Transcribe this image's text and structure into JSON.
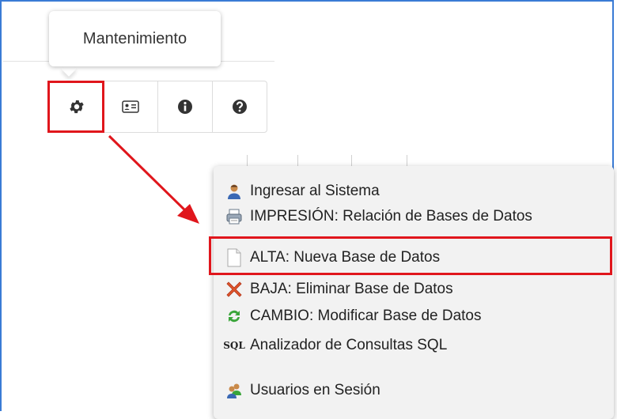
{
  "tooltip": {
    "text": "Mantenimiento"
  },
  "toolbar": {
    "buttons": [
      {
        "icon": "gear-icon"
      },
      {
        "icon": "id-card-icon"
      },
      {
        "icon": "info-circle-icon"
      },
      {
        "icon": "question-circle-icon"
      }
    ]
  },
  "menu": {
    "items": [
      {
        "label": "Ingresar al Sistema",
        "icon": "user-icon"
      },
      {
        "label": "IMPRESIÓN: Relación de Bases de Datos",
        "icon": "printer-icon"
      },
      {
        "label": "ALTA: Nueva Base de Datos",
        "icon": "blank-document-icon"
      },
      {
        "label": "BAJA: Eliminar Base de Datos",
        "icon": "red-x-icon"
      },
      {
        "label": "CAMBIO: Modificar Base de Datos",
        "icon": "refresh-icon"
      },
      {
        "label": "Analizador de Consultas SQL",
        "icon": "sql-icon",
        "icon_text": "SQL"
      },
      {
        "label": "Usuarios en Sesión",
        "icon": "users-icon"
      }
    ]
  },
  "colors": {
    "highlight": "#e0161c",
    "frame": "#3a7bd5"
  }
}
